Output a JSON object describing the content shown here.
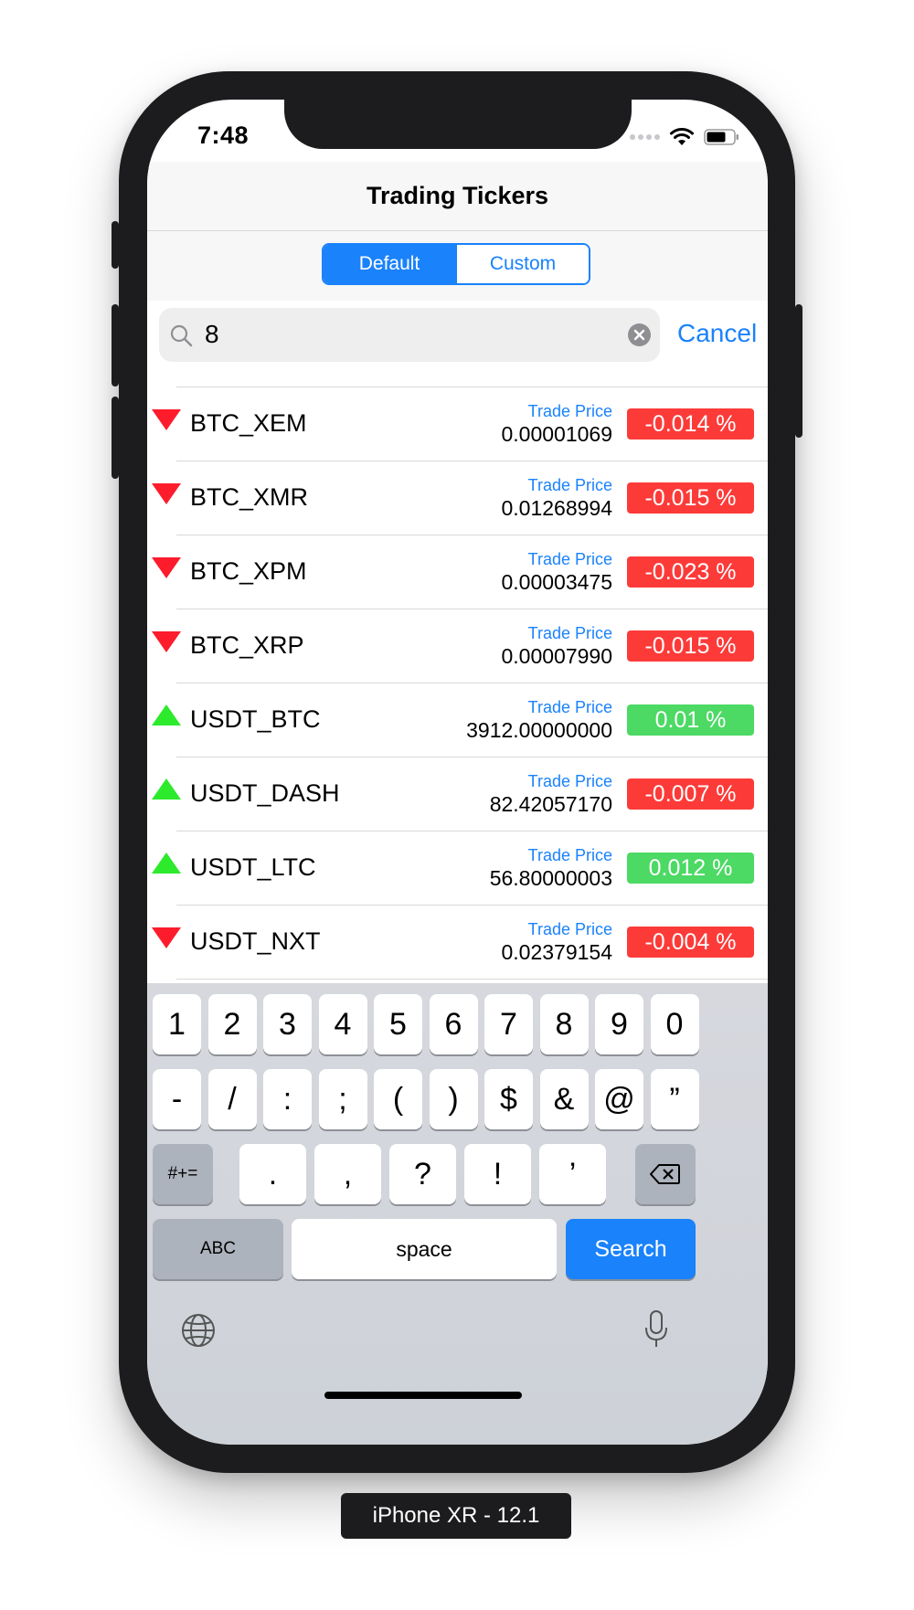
{
  "status_bar": {
    "time": "7:48"
  },
  "nav": {
    "title": "Trading Tickers"
  },
  "segments": {
    "default_label": "Default",
    "custom_label": "Custom",
    "selected": "Default"
  },
  "search": {
    "value": "8",
    "cancel_label": "Cancel"
  },
  "tickers": [
    {
      "symbol": "BTC_XEM",
      "label": "Trade Price",
      "price": "0.00001069",
      "change": "-0.014 %",
      "direction": "down",
      "change_sign": "neg"
    },
    {
      "symbol": "BTC_XMR",
      "label": "Trade Price",
      "price": "0.01268994",
      "change": "-0.015 %",
      "direction": "down",
      "change_sign": "neg"
    },
    {
      "symbol": "BTC_XPM",
      "label": "Trade Price",
      "price": "0.00003475",
      "change": "-0.023 %",
      "direction": "down",
      "change_sign": "neg"
    },
    {
      "symbol": "BTC_XRP",
      "label": "Trade Price",
      "price": "0.00007990",
      "change": "-0.015 %",
      "direction": "down",
      "change_sign": "neg"
    },
    {
      "symbol": "USDT_BTC",
      "label": "Trade Price",
      "price": "3912.00000000",
      "change": "0.01 %",
      "direction": "up",
      "change_sign": "pos"
    },
    {
      "symbol": "USDT_DASH",
      "label": "Trade Price",
      "price": "82.42057170",
      "change": "-0.007 %",
      "direction": "up",
      "change_sign": "neg"
    },
    {
      "symbol": "USDT_LTC",
      "label": "Trade Price",
      "price": "56.80000003",
      "change": "0.012 %",
      "direction": "up",
      "change_sign": "pos"
    },
    {
      "symbol": "USDT_NXT",
      "label": "Trade Price",
      "price": "0.02379154",
      "change": "-0.004 %",
      "direction": "down",
      "change_sign": "neg"
    }
  ],
  "keyboard": {
    "row1": [
      "1",
      "2",
      "3",
      "4",
      "5",
      "6",
      "7",
      "8",
      "9",
      "0"
    ],
    "row2": [
      "-",
      "/",
      ":",
      ";",
      "(",
      ")",
      "$",
      "&",
      "@",
      "”"
    ],
    "row3": [
      ".",
      ",",
      "?",
      "!",
      "’"
    ],
    "shift_label": "#+=",
    "abc_label": "ABC",
    "space_label": "space",
    "search_label": "Search"
  },
  "colors": {
    "accent": "#1a82fb",
    "negative": "#fc3b39",
    "positive": "#4cd964",
    "down_arrow": "#fc1c2c",
    "up_arrow": "#2dea2d"
  },
  "device_label": "iPhone XR - 12.1"
}
